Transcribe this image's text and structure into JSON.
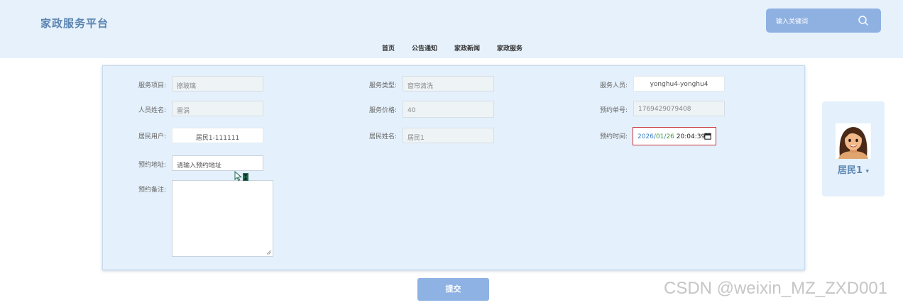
{
  "header": {
    "brand": "家政服务平台",
    "search_placeholder": "输入关键词",
    "nav": [
      "首页",
      "公告通知",
      "家政新闻",
      "家政服务"
    ]
  },
  "form": {
    "service_item": {
      "label": "服务项目:",
      "value": "擦玻璃"
    },
    "service_type": {
      "label": "服务类型:",
      "value": "窗帘清洗"
    },
    "staff": {
      "label": "服务人员:",
      "value": "yonghu4-yonghu4"
    },
    "staff_name": {
      "label": "人员姓名:",
      "value": "雷涡"
    },
    "service_price": {
      "label": "服务价格:",
      "value": "40"
    },
    "order_no": {
      "label": "预约单号:",
      "value": "1769429079408"
    },
    "resident_user": {
      "label": "居民用户:",
      "value": "居民1-111111"
    },
    "resident_name": {
      "label": "居民姓名:",
      "value": "居民1"
    },
    "appointment_time": {
      "label": "预约时间:",
      "year": "2026",
      "sep1": "/",
      "month": "01",
      "sep2": "/",
      "day": "26",
      "time": " 20:04:39"
    },
    "address": {
      "label": "预约地址:",
      "placeholder": "请输入预约地址"
    },
    "notes": {
      "label": "预约备注:"
    },
    "submit_label": "提交"
  },
  "user": {
    "name": "居民1",
    "caret": "▾"
  },
  "watermark": "CSDN @weixin_MZ_ZXD001",
  "icons": [
    "search-icon",
    "calendar-icon",
    "avatar",
    "resize-handle-icon",
    "cursor-icon"
  ],
  "colors": {
    "accent": "#8eb2e4",
    "header_bg": "#e6f1fb",
    "panel_bg": "#e4f0fb",
    "brand": "#5b84b1",
    "date_border": "#c8323b"
  }
}
